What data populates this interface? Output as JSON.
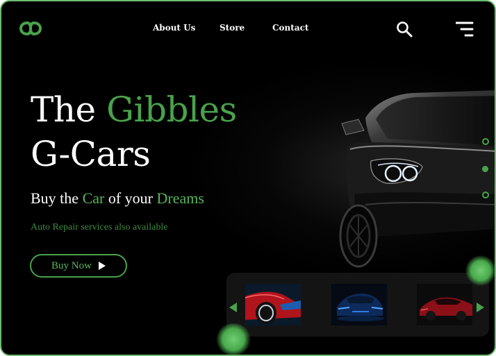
{
  "header": {
    "logo": "logo",
    "nav": [
      {
        "label": "About Us"
      },
      {
        "label": "Store"
      },
      {
        "label": "Contact"
      }
    ],
    "icons": [
      "search-icon",
      "menu-icon"
    ]
  },
  "hero": {
    "title_word1": "The",
    "title_word2": "Gibbles",
    "title_line2": "G-Cars",
    "subtitle_part1": "Buy the",
    "subtitle_part2": "Car",
    "subtitle_part3": "of your",
    "subtitle_part4": "Dreams",
    "note": "Auto Repair services also available",
    "button_label": "Buy Now"
  },
  "slider": {
    "active_index": 1,
    "count": 3
  },
  "gallery": {
    "thumbnails": [
      "red sports car",
      "blue sports car",
      "red sedan"
    ]
  },
  "colors": {
    "accent": "#49a34b",
    "background": "#000000",
    "border": "#6dbd6e"
  }
}
